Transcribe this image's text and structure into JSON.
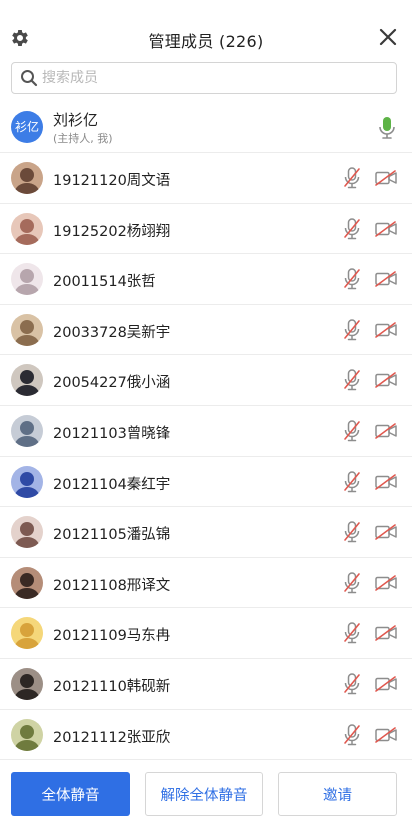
{
  "header": {
    "title": "管理成员 (226)",
    "settings_icon": "gear-icon",
    "close_icon": "close-icon"
  },
  "search": {
    "placeholder": "搜索成员",
    "value": ""
  },
  "host": {
    "avatar_text": "衫亿",
    "name": "刘衫亿",
    "role": "(主持人, 我)",
    "mic_status_icon": "microphone-on-icon"
  },
  "members": [
    {
      "name": "19121120周文语",
      "mic_icon": "microphone-muted-icon",
      "camera_icon": "camera-off-icon"
    },
    {
      "name": "19125202杨翊翔",
      "mic_icon": "microphone-muted-icon",
      "camera_icon": "camera-off-icon"
    },
    {
      "name": "20011514张哲",
      "mic_icon": "microphone-muted-icon",
      "camera_icon": "camera-off-icon"
    },
    {
      "name": "20033728吴新宇",
      "mic_icon": "microphone-muted-icon",
      "camera_icon": "camera-off-icon"
    },
    {
      "name": "20054227俄小涵",
      "mic_icon": "microphone-muted-icon",
      "camera_icon": "camera-off-icon"
    },
    {
      "name": "20121103曾晓锋",
      "mic_icon": "microphone-muted-icon",
      "camera_icon": "camera-off-icon"
    },
    {
      "name": "20121104秦红宇",
      "mic_icon": "microphone-muted-icon",
      "camera_icon": "camera-off-icon"
    },
    {
      "name": "20121105潘弘锦",
      "mic_icon": "microphone-muted-icon",
      "camera_icon": "camera-off-icon"
    },
    {
      "name": "20121108邢译文",
      "mic_icon": "microphone-muted-icon",
      "camera_icon": "camera-off-icon"
    },
    {
      "name": "20121109马东冉",
      "mic_icon": "microphone-muted-icon",
      "camera_icon": "camera-off-icon"
    },
    {
      "name": "20121110韩砚新",
      "mic_icon": "microphone-muted-icon",
      "camera_icon": "camera-off-icon"
    },
    {
      "name": "20121112张亚欣",
      "mic_icon": "microphone-muted-icon",
      "camera_icon": "camera-off-icon"
    }
  ],
  "footer": {
    "mute_all_label": "全体静音",
    "unmute_all_label": "解除全体静音",
    "invite_label": "邀请"
  },
  "colors": {
    "accent": "#2f6fe4",
    "host_avatar": "#3d7de6",
    "mic_on": "#5db346",
    "muted_red": "#e0584f",
    "icon_gray": "#8d8d8d"
  }
}
